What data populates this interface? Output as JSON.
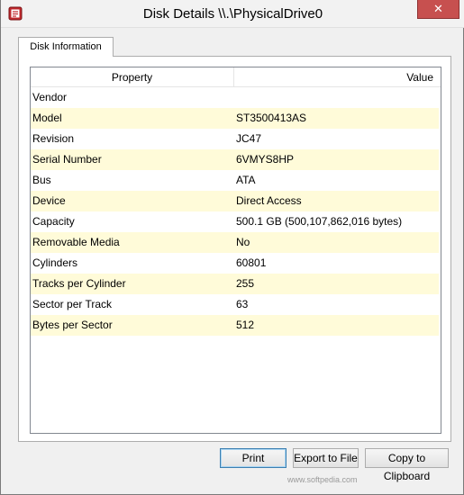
{
  "window": {
    "title": "Disk Details \\\\.\\PhysicalDrive0",
    "close_glyph": "✕"
  },
  "tabs": [
    {
      "label": "Disk Information"
    }
  ],
  "table": {
    "columns": [
      "Property",
      "Value"
    ],
    "rows": [
      {
        "property": "Vendor",
        "value": ""
      },
      {
        "property": "Model",
        "value": "ST3500413AS"
      },
      {
        "property": "Revision",
        "value": "JC47"
      },
      {
        "property": "Serial Number",
        "value": "6VMYS8HP"
      },
      {
        "property": "Bus",
        "value": "ATA"
      },
      {
        "property": "Device",
        "value": "Direct Access"
      },
      {
        "property": "Capacity",
        "value": "500.1 GB (500,107,862,016 bytes)"
      },
      {
        "property": "Removable Media",
        "value": "No"
      },
      {
        "property": "Cylinders",
        "value": "60801"
      },
      {
        "property": "Tracks per Cylinder",
        "value": "255"
      },
      {
        "property": "Sector per Track",
        "value": "63"
      },
      {
        "property": "Bytes per Sector",
        "value": "512"
      }
    ]
  },
  "buttons": {
    "print": "Print",
    "export": "Export to File",
    "copy": "Copy to Clipboard"
  },
  "watermark": "www.softpedia.com",
  "colors": {
    "alt_row": "#fffbd9",
    "close_button": "#c7504f"
  }
}
